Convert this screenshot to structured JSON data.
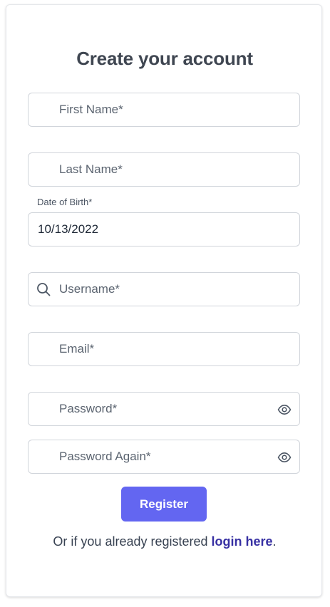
{
  "form": {
    "title": "Create your account",
    "first_name_placeholder": "First Name*",
    "last_name_placeholder": "Last Name*",
    "dob_label": "Date of Birth*",
    "dob_value": "10/13/2022",
    "username_placeholder": "Username*",
    "email_placeholder": "Email*",
    "password_placeholder": "Password*",
    "password_again_placeholder": "Password Again*",
    "register_label": "Register",
    "footer_prefix": "Or if you already registered ",
    "login_link": "login here",
    "footer_suffix": "."
  },
  "icons": {
    "username": "search-icon",
    "password_toggle": "eye-icon",
    "password_again_toggle": "eye-icon"
  },
  "colors": {
    "accent": "#6366f1",
    "link": "#3730a3",
    "title": "#3f4651",
    "border": "#d1d5db"
  }
}
